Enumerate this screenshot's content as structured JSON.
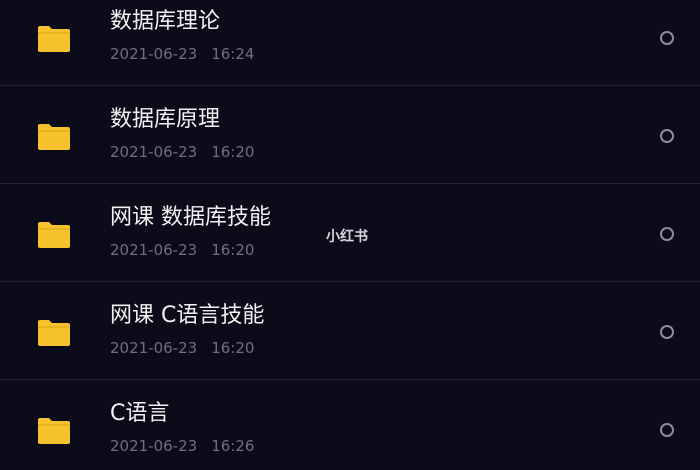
{
  "files": [
    {
      "name": "数据库理论",
      "date": "2021-06-23",
      "time": "16:24",
      "icon": "folder-icon"
    },
    {
      "name": "数据库原理",
      "date": "2021-06-23",
      "time": "16:20",
      "icon": "folder-icon"
    },
    {
      "name": "网课 数据库技能",
      "date": "2021-06-23",
      "time": "16:20",
      "icon": "folder-icon"
    },
    {
      "name": "网课 C语言技能",
      "date": "2021-06-23",
      "time": "16:20",
      "icon": "folder-icon"
    },
    {
      "name": "C语言",
      "date": "2021-06-23",
      "time": "16:26",
      "icon": "folder-icon"
    }
  ],
  "watermark": {
    "text": "小红书"
  },
  "colors": {
    "background": "#0b0b1a",
    "folder": "#f6c22d",
    "name_text": "#f2f2f2",
    "meta_text": "#6f6f82",
    "divider": "#22222f",
    "radio": "#8d8d9a"
  }
}
